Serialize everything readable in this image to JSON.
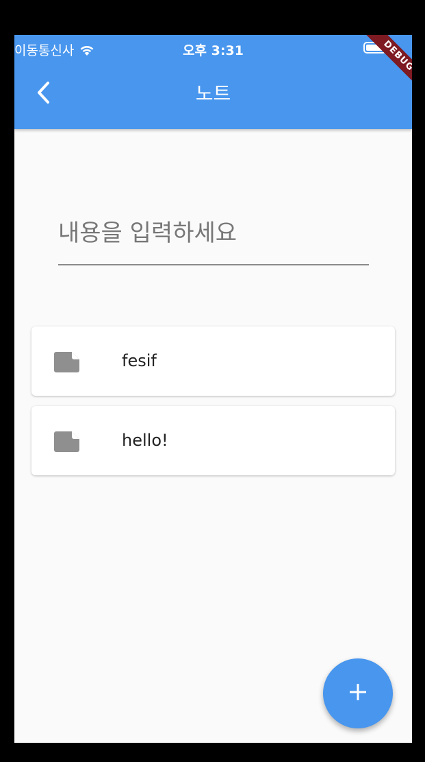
{
  "status_bar": {
    "carrier": "이동통신사",
    "time": "오후 3:31",
    "wifi_icon": "wifi-icon",
    "battery_icon": "battery-icon"
  },
  "app_bar": {
    "title": "노트",
    "back_icon": "chevron-left-icon",
    "background_color": "#4896ee"
  },
  "debug_banner": {
    "label": "DEBUG",
    "color": "#7d1a22"
  },
  "note_input": {
    "placeholder": "내용을 입력하세요",
    "value": ""
  },
  "notes": [
    {
      "title": "fesif",
      "icon": "note-icon"
    },
    {
      "title": "hello!",
      "icon": "note-icon"
    }
  ],
  "fab": {
    "icon": "plus-icon",
    "color": "#4896ee"
  },
  "colors": {
    "background": "#fafafa",
    "card": "#ffffff",
    "icon_gray": "#8f8f8f"
  }
}
